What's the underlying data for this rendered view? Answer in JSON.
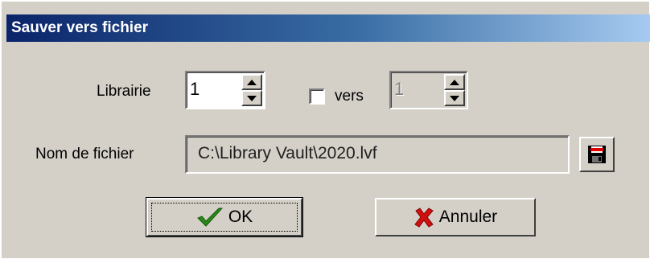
{
  "window": {
    "title": "Sauver vers fichier"
  },
  "library": {
    "label": "Librairie",
    "value": "1"
  },
  "to_library": {
    "label": "vers",
    "checked": false,
    "value": "1",
    "enabled": false
  },
  "file": {
    "label": "Nom de fichier",
    "path": "C:\\Library Vault\\2020.lvf",
    "browse_icon": "floppy-disk-icon"
  },
  "buttons": {
    "ok": {
      "label": "OK",
      "icon": "checkmark-icon"
    },
    "cancel": {
      "label": "Annuler",
      "icon": "red-x-icon"
    }
  },
  "colors": {
    "face": "#d4d0c8",
    "title_start": "#0a246a",
    "title_end": "#a6caf0",
    "ok_check": "#2a8a1a",
    "cancel_x": "#d01010"
  }
}
